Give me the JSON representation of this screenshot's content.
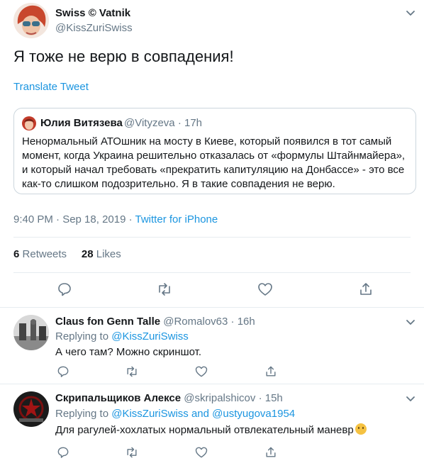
{
  "main_tweet": {
    "display_name": "Swiss © Vatnik",
    "handle": "@KissZuriSwiss",
    "text": "Я тоже не верю в совпадения!",
    "translate_label": "Translate Tweet",
    "quote": {
      "display_name": "Юлия Витязева",
      "handle": "@Vityzeva",
      "separator": "·",
      "time": "17h",
      "text": "Ненормальный АТОшник на мосту в Киеве, который появился в тот самый момент, когда Украина решительно отказалась от «формулы Штайнмайера», и который начал требовать «прекратить капитуляцию на Донбассе» - это все как-то слишком подозрительно. Я в такие совпадения не верю."
    },
    "timestamp": "9:40 PM · Sep 18, 2019",
    "meta_separator": "·",
    "source": "Twitter for iPhone",
    "retweets_count": "6",
    "retweets_label": "Retweets",
    "likes_count": "28",
    "likes_label": "Likes"
  },
  "replies": [
    {
      "display_name": "Claus fon Genn Talle",
      "handle": "@Romalov63",
      "separator": "·",
      "time": "16h",
      "replying_label": "Replying to",
      "replying_to": "@KissZuriSwiss",
      "replying_and": "",
      "replying_to_2": "",
      "text": "А чего там? Можно скриншот."
    },
    {
      "display_name": "Скрипальщиков Алексе",
      "handle": "@skripalshicov",
      "separator": "·",
      "time": "15h",
      "replying_label": "Replying to",
      "replying_to": "@KissZuriSwiss",
      "replying_and": "and",
      "replying_to_2": "@ustyugova1954",
      "text": "Для рагулей-хохлатых нормальный отвлекательный маневр",
      "emoji": "thinking-face-emoji"
    }
  ],
  "icons": [
    "chevron-down-icon",
    "reply-icon",
    "retweet-icon",
    "like-icon",
    "share-icon"
  ],
  "colors": {
    "link": "#1b95e0",
    "muted": "#657786",
    "text": "#14171a",
    "divider": "#e6ecf0"
  }
}
